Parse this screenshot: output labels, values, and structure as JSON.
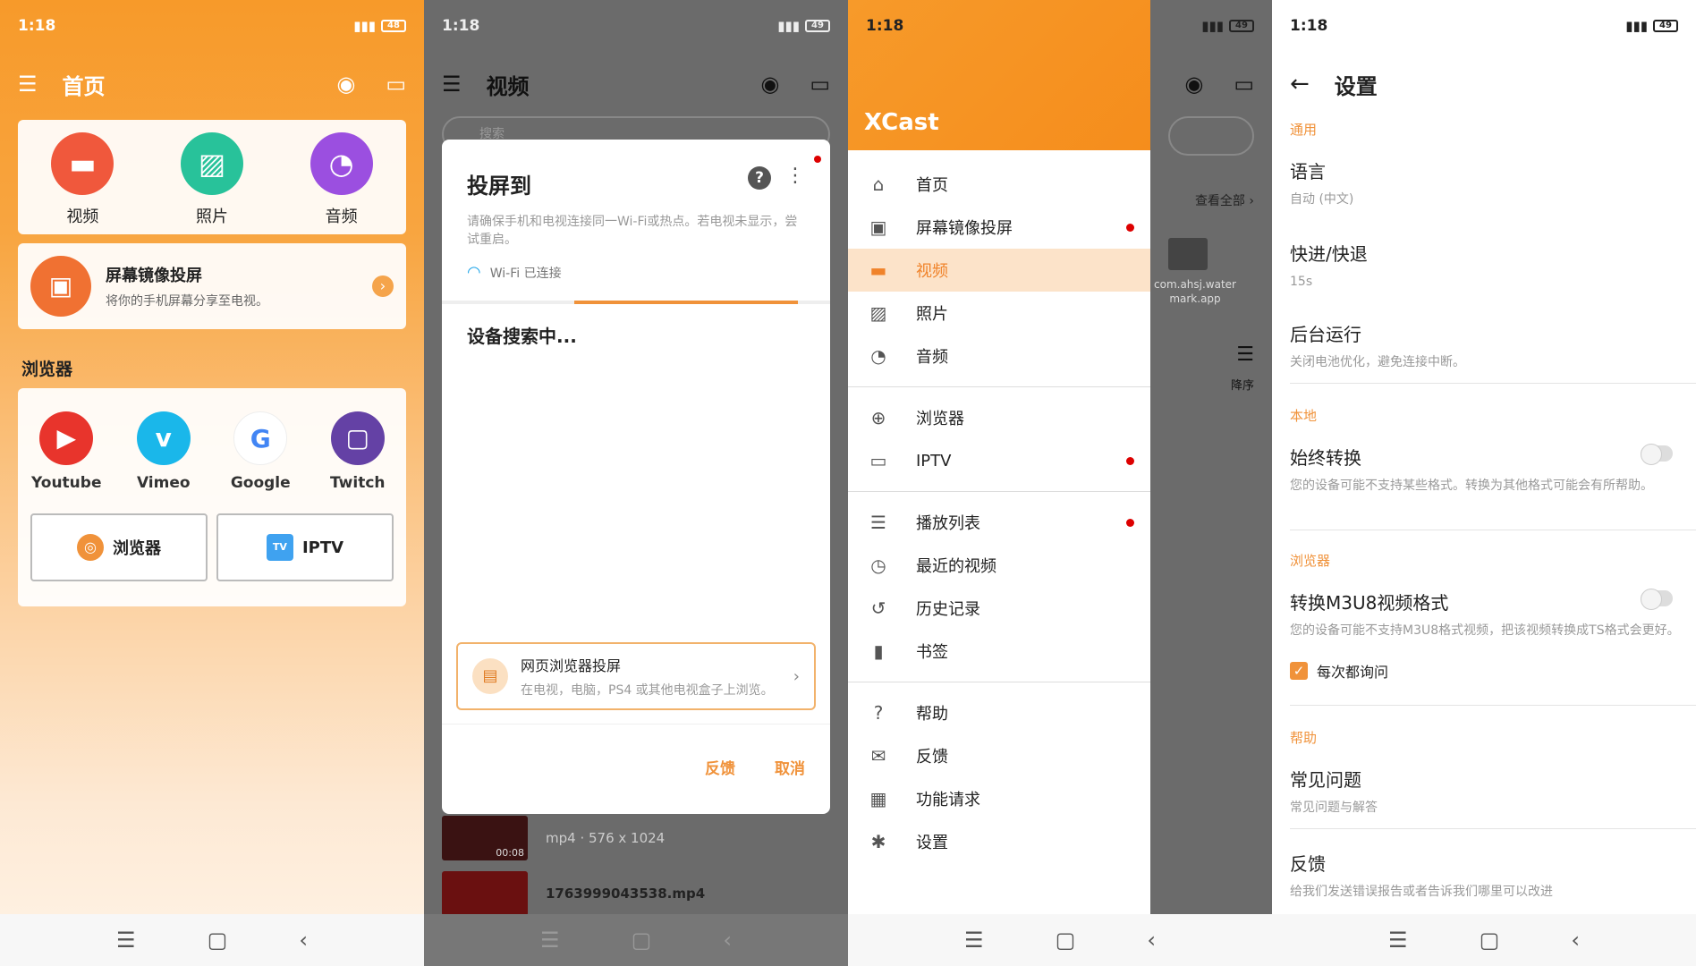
{
  "status_time": "1:18",
  "battery": [
    "48",
    "49",
    "49",
    "49"
  ],
  "screen1": {
    "title": "首页",
    "media": [
      {
        "label": "视频",
        "icon": "video-icon",
        "color": "#f0583c"
      },
      {
        "label": "照片",
        "icon": "photo-icon",
        "color": "#28c29a"
      },
      {
        "label": "音频",
        "icon": "music-icon",
        "color": "#9b4fe0"
      }
    ],
    "mirror": {
      "title": "屏幕镜像投屏",
      "subtitle": "将你的手机屏幕分享至电视。"
    },
    "browser_section": "浏览器",
    "sites": [
      {
        "label": "Youtube",
        "glyph": "▶",
        "color": "#e8342c"
      },
      {
        "label": "Vimeo",
        "glyph": "v",
        "color": "#1ab7ea"
      },
      {
        "label": "Google",
        "glyph": "G",
        "color": "#ffffff"
      },
      {
        "label": "Twitch",
        "glyph": "▢",
        "color": "#6441a5"
      }
    ],
    "buttons": [
      {
        "label": "浏览器",
        "glyph": "◎",
        "color": "#f0923a"
      },
      {
        "label": "IPTV",
        "glyph": "TV",
        "color": "#3fa2f0"
      }
    ]
  },
  "screen2": {
    "title": "视频",
    "dialog": {
      "title": "投屏到",
      "note": "请确保手机和电视连接同一Wi-Fi或热点。若电视未显示，尝试重启。",
      "wifi": "Wi-Fi 已连接",
      "searching": "设备搜索中...",
      "web_title": "网页浏览器投屏",
      "web_sub": "在电视，电脑，PS4 或其他电视盒子上浏览。",
      "feedback": "反馈",
      "cancel": "取消"
    },
    "video1": {
      "meta": "mp4 · 576 x 1024",
      "duration": "00:08"
    },
    "video2": {
      "name": "1763999043538.mp4"
    },
    "search_placeholder": "搜索"
  },
  "screen3": {
    "logo": "XCast",
    "items": [
      {
        "label": "首页",
        "icon": "home-icon",
        "glyph": "⌂",
        "dot": false,
        "selected": false
      },
      {
        "label": "屏幕镜像投屏",
        "icon": "mirror-icon",
        "glyph": "▣",
        "dot": true,
        "selected": false
      },
      {
        "label": "视频",
        "icon": "video-icon",
        "glyph": "▬",
        "dot": false,
        "selected": true
      },
      {
        "label": "照片",
        "icon": "photo-icon",
        "glyph": "▨",
        "dot": false,
        "selected": false
      },
      {
        "label": "音频",
        "icon": "music-icon",
        "glyph": "◔",
        "dot": false,
        "selected": false
      },
      {
        "label": "浏览器",
        "icon": "globe-icon",
        "glyph": "⊕",
        "dot": false,
        "selected": false
      },
      {
        "label": "IPTV",
        "icon": "tv-icon",
        "glyph": "▭",
        "dot": true,
        "selected": false
      },
      {
        "label": "播放列表",
        "icon": "playlist-icon",
        "glyph": "☰",
        "dot": true,
        "selected": false
      },
      {
        "label": "最近的视频",
        "icon": "clock-icon",
        "glyph": "◷",
        "dot": false,
        "selected": false
      },
      {
        "label": "历史记录",
        "icon": "history-icon",
        "glyph": "↺",
        "dot": false,
        "selected": false
      },
      {
        "label": "书签",
        "icon": "bookmark-icon",
        "glyph": "▮",
        "dot": false,
        "selected": false
      },
      {
        "label": "帮助",
        "icon": "help-icon",
        "glyph": "?",
        "dot": false,
        "selected": false
      },
      {
        "label": "反馈",
        "icon": "feedback-icon",
        "glyph": "✉",
        "dot": false,
        "selected": false
      },
      {
        "label": "功能请求",
        "icon": "apps-icon",
        "glyph": "▦",
        "dot": false,
        "selected": false
      },
      {
        "label": "设置",
        "icon": "gear-icon",
        "glyph": "✱",
        "dot": false,
        "selected": false
      }
    ],
    "view_all": "查看全部 ›",
    "folder": "com.ahsj.watermark.app",
    "sort": "降序"
  },
  "screen4": {
    "title": "设置",
    "general": "通用",
    "language": "语言",
    "language_val": "自动 (中文)",
    "seek": "快进/快退",
    "seek_val": "15s",
    "background": "后台运行",
    "background_val": "关闭电池优化，避免连接中断。",
    "local": "本地",
    "always_convert": "始终转换",
    "always_convert_val": "您的设备可能不支持某些格式。转换为其他格式可能会有所帮助。",
    "browser": "浏览器",
    "m3u8": "转换M3U8视频格式",
    "m3u8_val": "您的设备可能不支持M3U8格式视频，把该视频转换成TS格式会更好。",
    "ask": "每次都询问",
    "help": "帮助",
    "faq": "常见问题",
    "faq_val": "常见问题与解答",
    "feedback": "反馈",
    "feedback_val": "给我们发送错误报告或者告诉我们哪里可以改进"
  }
}
